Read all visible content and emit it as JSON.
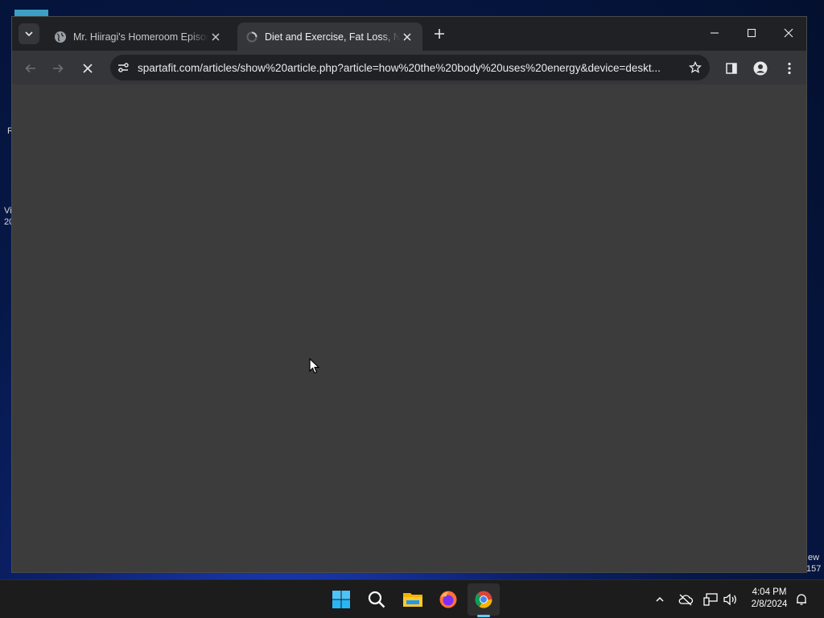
{
  "desktop": {
    "left_text_1": "R",
    "left_text_2": "Vi",
    "left_text_3": "20",
    "right_text_1": "ew",
    "right_text_2": "157"
  },
  "tabs": [
    {
      "title": "Mr. Hiiragi's Homeroom Episode",
      "active": false,
      "icon": "globe-icon"
    },
    {
      "title": "Diet and Exercise, Fat Loss, Nutrition",
      "active": true,
      "icon": "loading-icon"
    }
  ],
  "address_bar": {
    "url": "spartafit.com/articles/show%20article.php?article=how%20the%20body%20uses%20energy&device=deskt..."
  },
  "taskbar": {
    "time": "4:04 PM",
    "date": "2/8/2024",
    "apps": [
      "windows-start-icon",
      "search-icon",
      "file-explorer-icon",
      "firefox-icon",
      "chrome-icon"
    ],
    "active_app": "chrome-icon"
  },
  "colors": {
    "tab_bar": "#202124",
    "toolbar": "#35363a",
    "content": "#3c3c3c",
    "accent": "#60cdff"
  }
}
